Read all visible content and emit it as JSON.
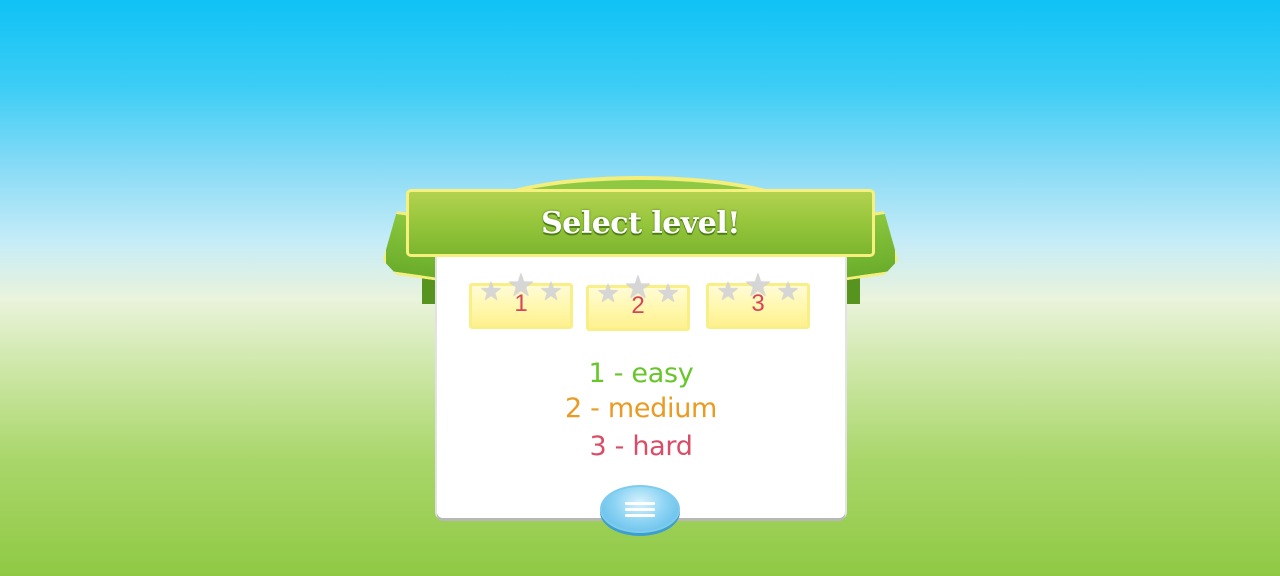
{
  "dialog": {
    "title": "Select level!"
  },
  "levels": [
    {
      "label": "1",
      "stars_filled": 0,
      "stars_total": 3
    },
    {
      "label": "2",
      "stars_filled": 0,
      "stars_total": 3
    },
    {
      "label": "3",
      "stars_filled": 0,
      "stars_total": 3
    }
  ],
  "legend": {
    "easy": "1 - easy",
    "medium": "2 - medium",
    "hard": "3 - hard"
  },
  "menu_button": {
    "icon": "menu-icon"
  },
  "colors": {
    "banner_green": "#93c43a",
    "banner_border": "#f6f07e",
    "level_number": "#d9435a",
    "easy": "#67c62a",
    "medium": "#e99b24",
    "hard": "#d94d66",
    "menu_blue": "#8fd5f4"
  }
}
